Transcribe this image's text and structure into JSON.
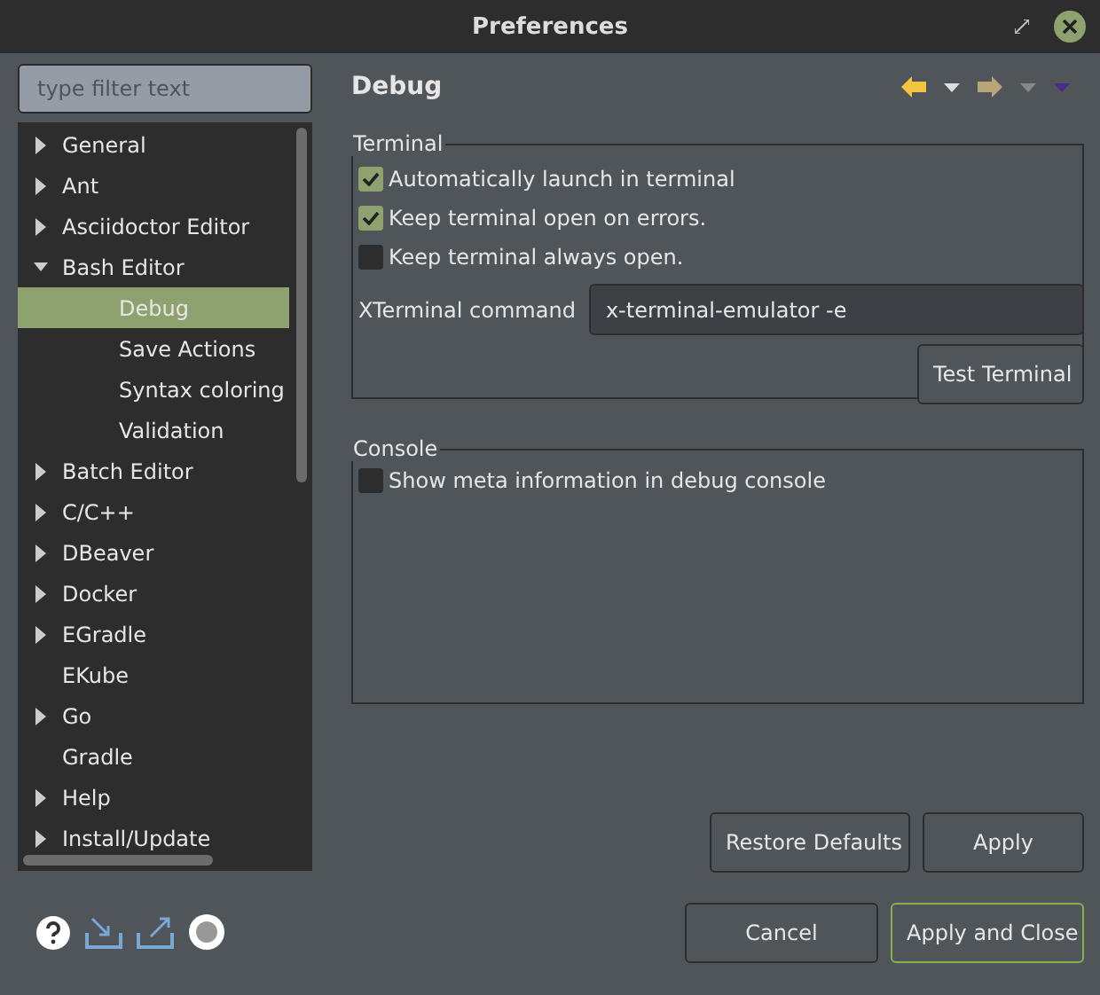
{
  "window": {
    "title": "Preferences"
  },
  "filter": {
    "placeholder": "type filter text"
  },
  "tree": [
    {
      "label": "General",
      "expanded": false
    },
    {
      "label": "Ant",
      "expanded": false
    },
    {
      "label": "Asciidoctor Editor",
      "expanded": false
    },
    {
      "label": "Bash Editor",
      "expanded": true,
      "children": [
        {
          "label": "Debug",
          "selected": true
        },
        {
          "label": "Save Actions",
          "selected": false
        },
        {
          "label": "Syntax coloring",
          "selected": false
        },
        {
          "label": "Validation",
          "selected": false
        }
      ]
    },
    {
      "label": "Batch Editor",
      "expanded": false
    },
    {
      "label": "C/C++",
      "expanded": false
    },
    {
      "label": "DBeaver",
      "expanded": false
    },
    {
      "label": "Docker",
      "expanded": false
    },
    {
      "label": "EGradle",
      "expanded": false
    },
    {
      "label": "EKube"
    },
    {
      "label": "Go",
      "expanded": false
    },
    {
      "label": "Gradle"
    },
    {
      "label": "Help",
      "expanded": false
    },
    {
      "label": "Install/Update",
      "expanded": false
    }
  ],
  "page": {
    "title": "Debug"
  },
  "terminal": {
    "title": "Terminal",
    "options": [
      {
        "label": "Automatically launch in terminal",
        "checked": true
      },
      {
        "label": "Keep terminal open on errors.",
        "checked": true
      },
      {
        "label": "Keep terminal always open.",
        "checked": false
      }
    ],
    "command_label": "XTerminal command",
    "command_value": "x-terminal-emulator -e",
    "test_button": "Test Terminal"
  },
  "console": {
    "title": "Console",
    "options": [
      {
        "label": "Show meta information in debug console",
        "checked": false
      }
    ]
  },
  "page_buttons": [
    "Restore Defaults",
    "Apply"
  ],
  "dialog_buttons": [
    {
      "label": "Cancel",
      "default": false
    },
    {
      "label": "Apply and Close",
      "default": true
    }
  ]
}
